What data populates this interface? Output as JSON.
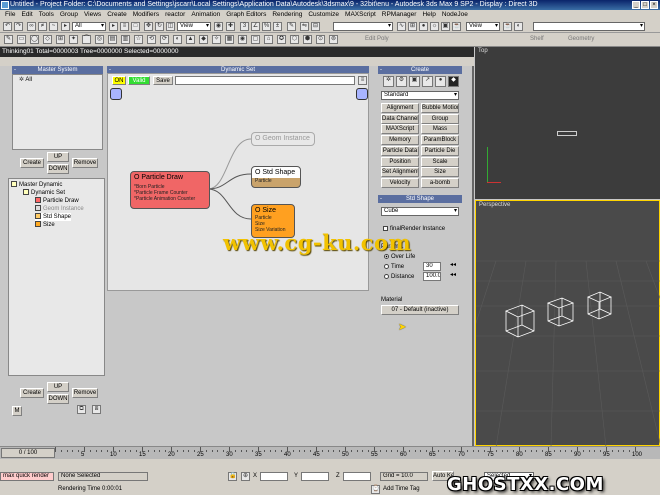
{
  "window": {
    "title": "Untitled   - Project Folder: C:\\Documents and Settings\\jscarr\\Local Settings\\Application Data\\Autodesk\\3dsmax\\9 - 32bit\\enu      - Autodesk 3ds Max 9 SP2      - Display : Direct 3D"
  },
  "menu": [
    "File",
    "Edit",
    "Tools",
    "Group",
    "Views",
    "Create",
    "Modifiers",
    "reactor",
    "Animation",
    "Graph Editors",
    "Rendering",
    "Customize",
    "MAXScript",
    "RPManager",
    "Help",
    "NodeJoe"
  ],
  "toolbar": {
    "selection_filter": "All",
    "view_combo1": "View",
    "view_combo2": "View",
    "edit_poly": "Edit Poly",
    "shelf": "Shelf",
    "geometry": "Geometry"
  },
  "subtitle": "Thinking01  Total=0000003  Tree=0000000  Selected=0000000",
  "master_panel": {
    "header": "Master System",
    "root": "All",
    "create": "Create",
    "up": "UP",
    "down": "DOWN",
    "remove": "Remove"
  },
  "tree": {
    "items": [
      "Master Dynamic",
      "Dynamic Set",
      "Particle Draw",
      "Geom Instance",
      "Std Shape",
      "Size"
    ]
  },
  "lower_panel": {
    "create": "Create",
    "up": "UP",
    "down": "DOWN",
    "remove": "Remove",
    "m": "M"
  },
  "dynamic_set": {
    "header": "Dynamic Set",
    "on": "ON",
    "valid": "Valid",
    "save": "Save"
  },
  "nodes": {
    "particle_draw": {
      "title": "O Particle Draw",
      "lines": [
        "*Born Particle",
        "*Particle Frame Counter",
        "*Particle Animation Counter"
      ],
      "color": "#f06666"
    },
    "geom_instance": {
      "title": "O Geom Instance"
    },
    "std_shape": {
      "title": "O Std Shape",
      "sub": "Particle"
    },
    "size": {
      "title": "O Size",
      "lines": [
        "Particle",
        "Size",
        "Size Variation"
      ],
      "color": "#ffa020"
    }
  },
  "watermark": "www.cg-ku.com",
  "create_panel": {
    "header": "Create",
    "category": "Standard",
    "buttons": [
      "Alignment",
      "Bubble Motion",
      "Data Channel",
      "Group",
      "MAXScript",
      "Mass",
      "Memory",
      "ParamBlock",
      "Particle Data",
      "Particle Die",
      "Position",
      "Scale",
      "Set Alignment",
      "Size",
      "Velocity",
      "a-bomb"
    ]
  },
  "std_shape_panel": {
    "header": "Std Shape",
    "shape": "Cube",
    "final_render": "finalRender Instance",
    "param_label": "Param...",
    "over_life": "Over Life",
    "time": "Time",
    "time_val": "30",
    "distance": "Distance",
    "distance_val": "100.0",
    "material_label": "Material",
    "material_btn": "07 - Default (inactive)"
  },
  "viewports": {
    "top": "Top",
    "perspective": "Perspective"
  },
  "timeline": {
    "slider": "0 / 100",
    "ticks": [
      "5",
      "10",
      "15",
      "20",
      "25",
      "30",
      "35",
      "40",
      "45",
      "50",
      "55",
      "60",
      "65",
      "70",
      "75",
      "80",
      "85",
      "90",
      "95",
      "100"
    ]
  },
  "status": {
    "script": "max quick render",
    "selection": "None Selected",
    "rendering": "Rendering Time  0:00:01",
    "x_label": "X",
    "y_label": "Y",
    "z_label": "Z",
    "grid": "Grid = 10.0",
    "add_time_tag": "Add Time Tag",
    "auto_key": "Auto Key",
    "selected": "Selected"
  },
  "site_watermark": "GHOSTXX.COM",
  "colors": {
    "node_green": "#40d040",
    "node_orange": "#ffa020",
    "node_red": "#f06666"
  }
}
